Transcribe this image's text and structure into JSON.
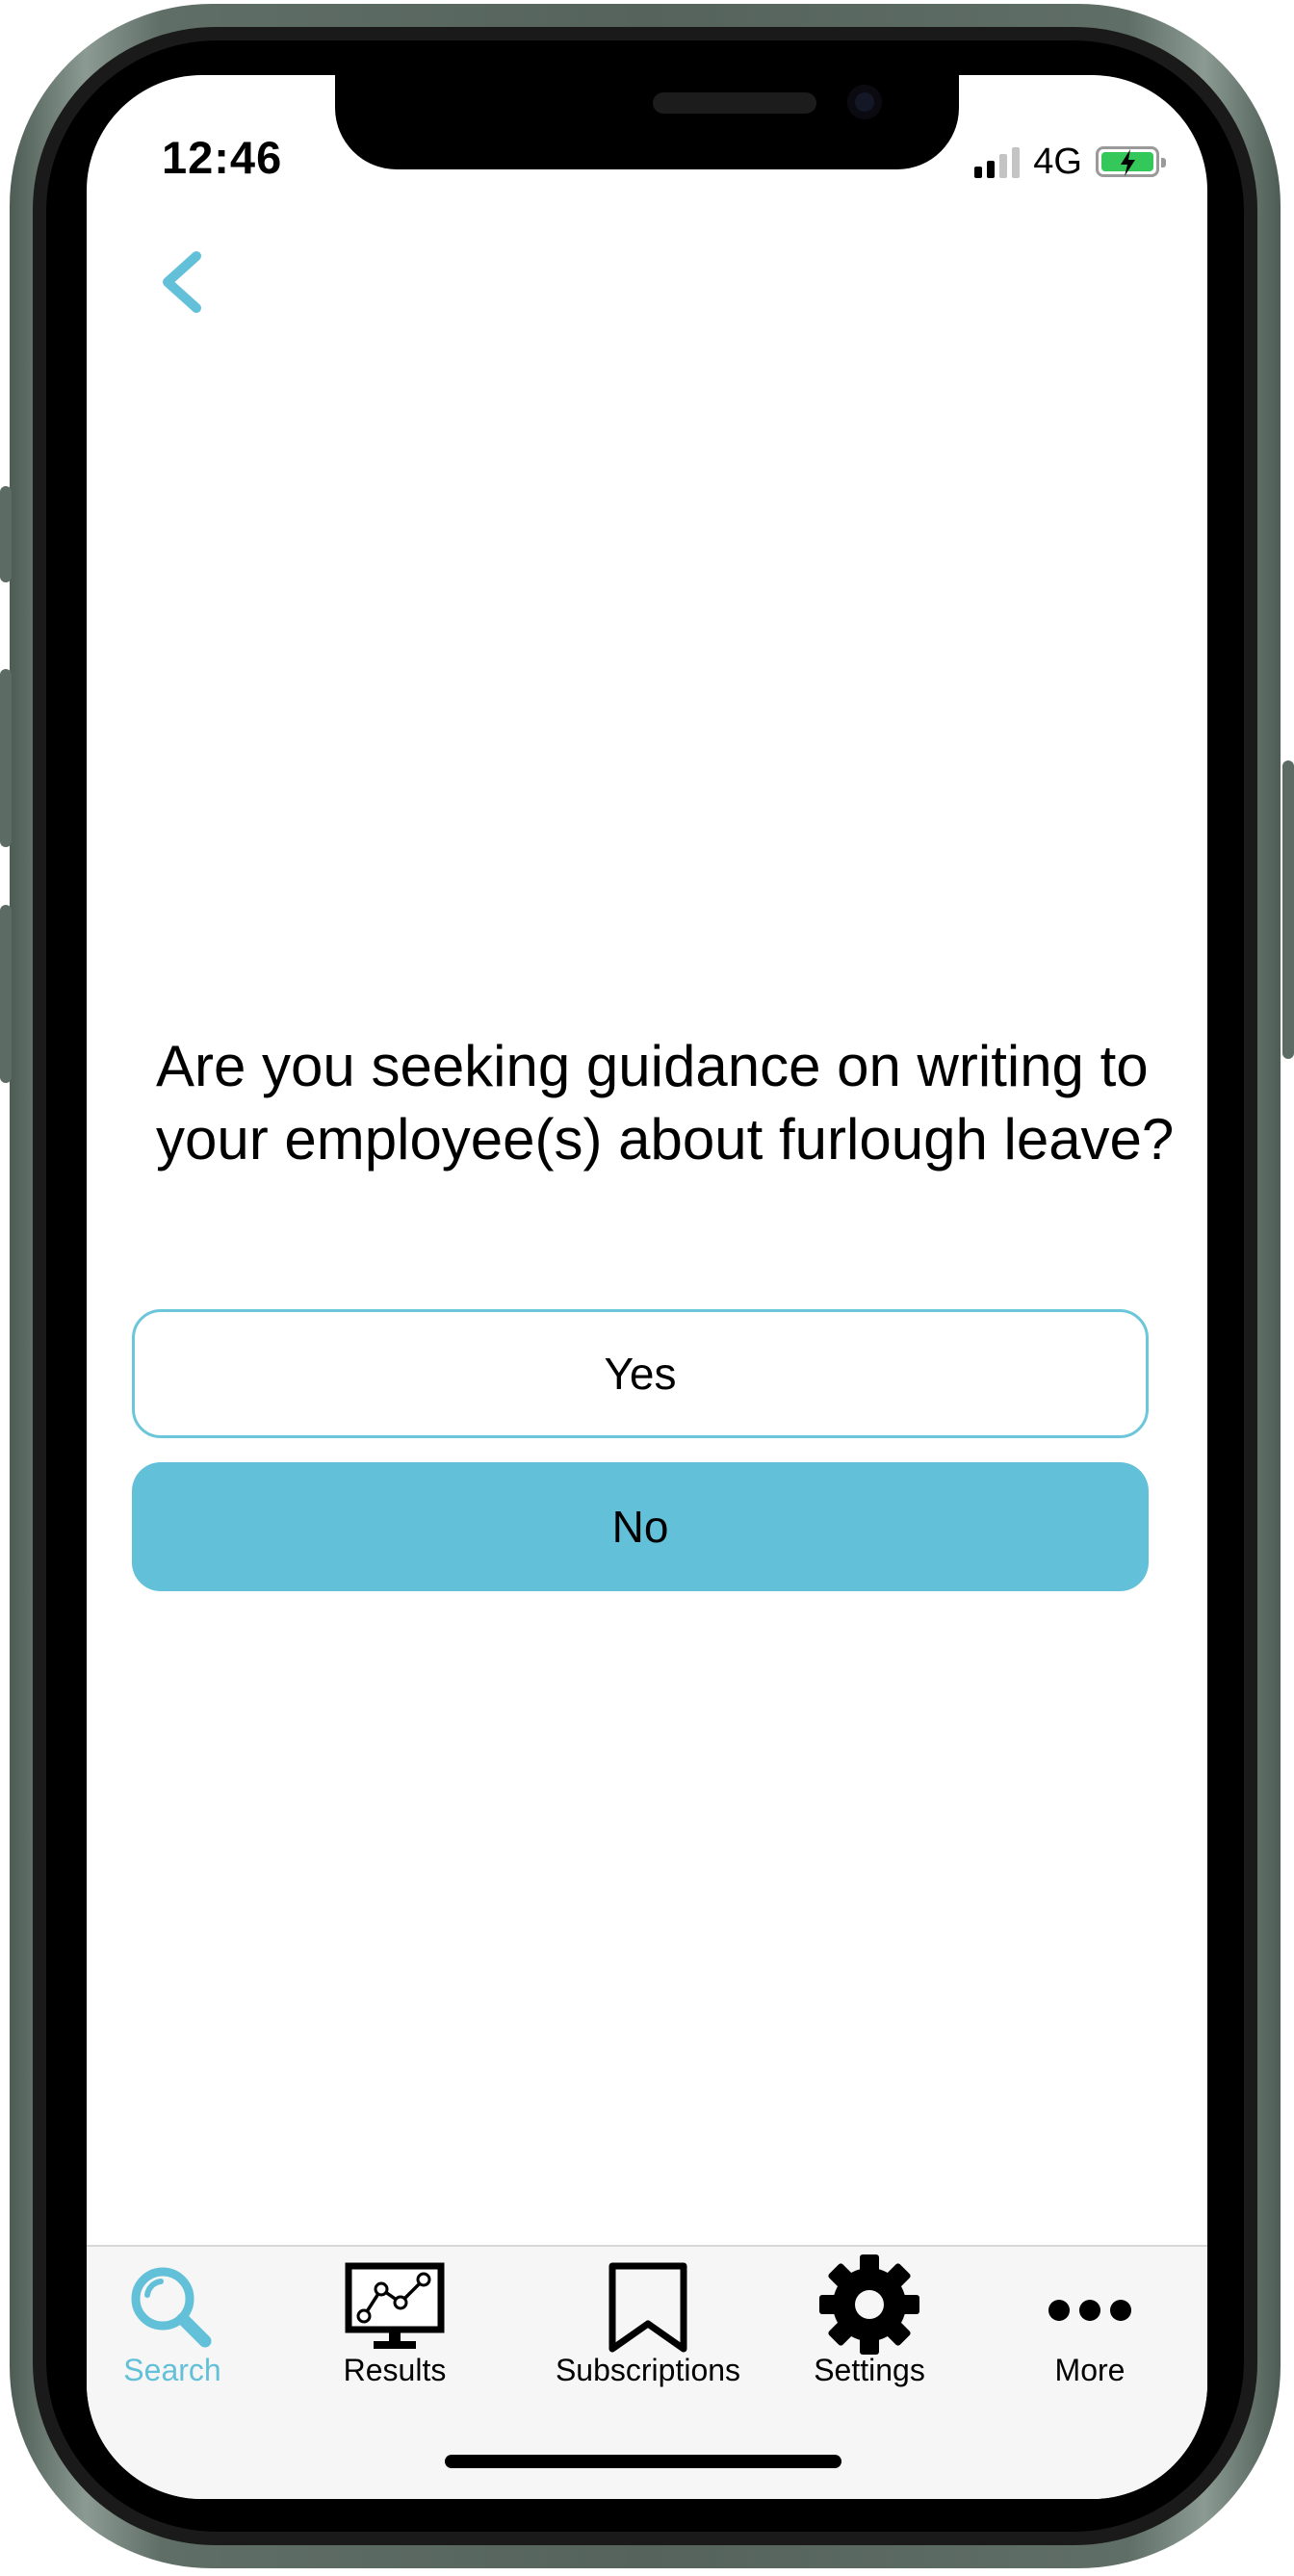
{
  "status_bar": {
    "time": "12:46",
    "network": "4G"
  },
  "question": {
    "text": "Are you seeking guidance on writing to your employee(s) about furlough leave?"
  },
  "answers": {
    "yes_label": "Yes",
    "no_label": "No"
  },
  "tab_bar": {
    "items": [
      {
        "label": "Search",
        "icon": "search-icon",
        "active": true
      },
      {
        "label": "Results",
        "icon": "monitor-chart-icon",
        "active": false
      },
      {
        "label": "Subscriptions",
        "icon": "bookmark-icon",
        "active": false
      },
      {
        "label": "Settings",
        "icon": "gear-icon",
        "active": false
      },
      {
        "label": "More",
        "icon": "ellipsis-icon",
        "active": false
      }
    ]
  },
  "colors": {
    "accent": "#62c1d8",
    "yes_border": "#6cc6d9",
    "battery": "#34c759"
  }
}
